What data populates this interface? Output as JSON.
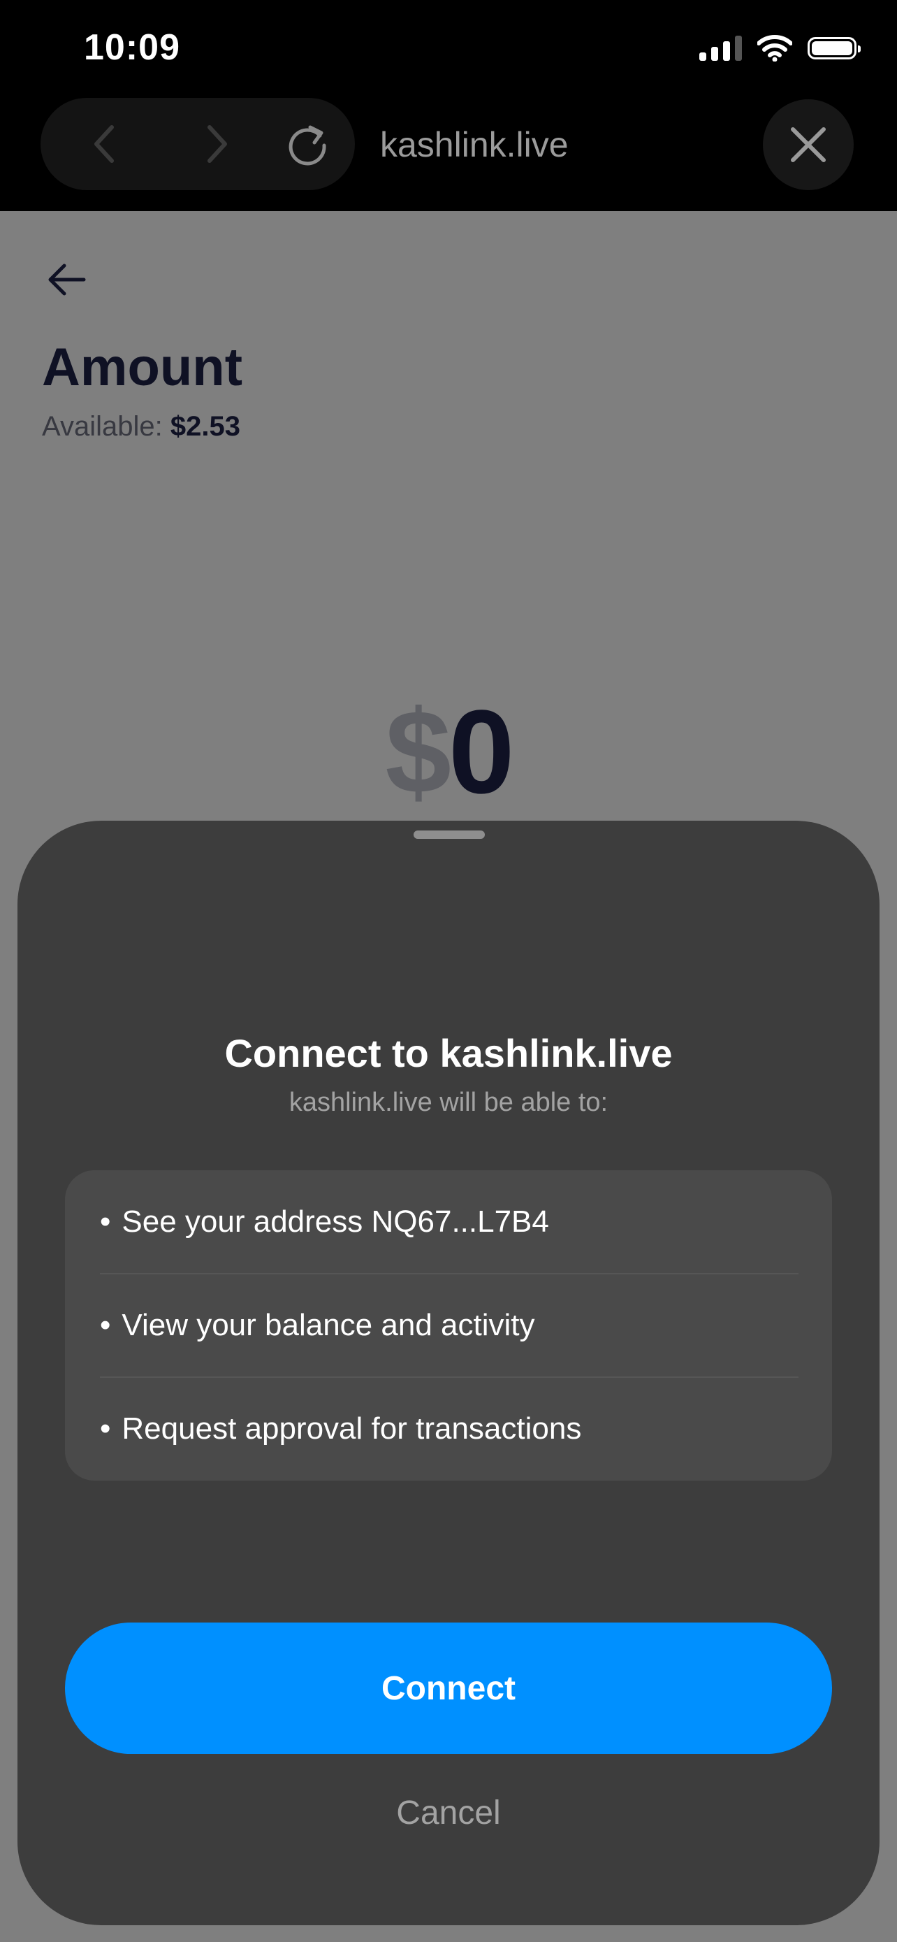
{
  "status_bar": {
    "time": "10:09",
    "icons": [
      "cellular-signal-icon",
      "wifi-icon",
      "battery-icon"
    ]
  },
  "browser": {
    "url": "kashlink.live",
    "icons": [
      "chevron-left-icon",
      "chevron-right-icon",
      "reload-icon",
      "close-icon"
    ]
  },
  "page": {
    "title": "Amount",
    "available_label": "Available:",
    "available_amount": "$2.53",
    "currency_symbol": "$",
    "amount_value": "0"
  },
  "sheet": {
    "title": "Connect to kashlink.live",
    "subtitle": "kashlink.live will be able to:",
    "permissions": [
      {
        "bullet": "•",
        "label": "See your address NQ67...L7B4"
      },
      {
        "bullet": "•",
        "label": "View your balance and activity"
      },
      {
        "bullet": "•",
        "label": "Request approval for transactions"
      }
    ],
    "connect_label": "Connect",
    "cancel_label": "Cancel"
  },
  "colors": {
    "accent": "#0090ff",
    "sheet_background": "#3d3d3d",
    "card_background": "#4a4a4a",
    "page_title": "#1f2348"
  }
}
